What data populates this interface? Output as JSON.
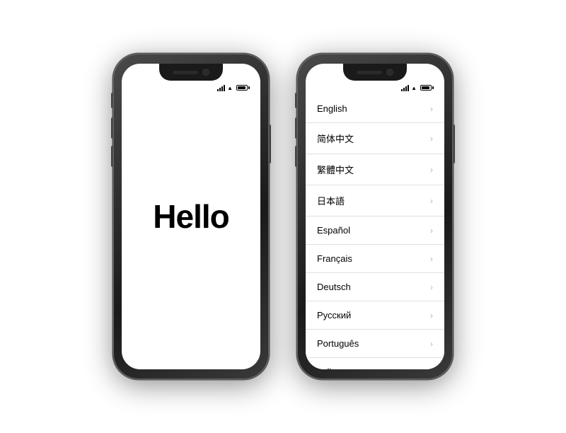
{
  "phones": {
    "left": {
      "hello_text": "Hello",
      "status": {
        "signal_bars": [
          3,
          5,
          7,
          9,
          11
        ],
        "wifi": "WiFi",
        "battery": 75
      }
    },
    "right": {
      "status": {
        "signal_bars": [
          3,
          5,
          7,
          9,
          11
        ],
        "wifi": "WiFi",
        "battery": 75
      },
      "languages": [
        {
          "id": "en",
          "label": "English"
        },
        {
          "id": "zh-hans",
          "label": "简体中文"
        },
        {
          "id": "zh-hant",
          "label": "繁體中文"
        },
        {
          "id": "ja",
          "label": "日本語"
        },
        {
          "id": "es",
          "label": "Español"
        },
        {
          "id": "fr",
          "label": "Français"
        },
        {
          "id": "de",
          "label": "Deutsch"
        },
        {
          "id": "ru",
          "label": "Русский"
        },
        {
          "id": "pt",
          "label": "Português"
        },
        {
          "id": "it",
          "label": "Italiano"
        }
      ],
      "chevron": "›"
    }
  }
}
